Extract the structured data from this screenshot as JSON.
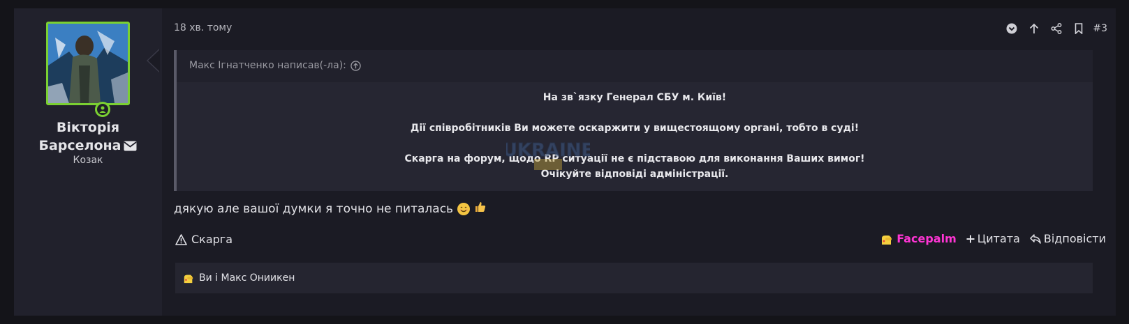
{
  "colors": {
    "avatar_border": "#7bd032",
    "reaction_accent": "#ff35d4",
    "background": "#1b1b24"
  },
  "user": {
    "name_line1": "Вікторія",
    "name_line2": "Барселона",
    "title": "Козак",
    "online": true
  },
  "post": {
    "date": "18 хв. тому",
    "number": "#3",
    "tools": [
      "chevron-down-circle-icon",
      "arrow-up-icon",
      "share-icon",
      "bookmark-icon"
    ]
  },
  "quote": {
    "header": "Макс Ігнатченко написав(-ла):",
    "lines": [
      "На зв`язку Генерал СБУ м. Київ!",
      "Дії співробітників Ви можете оскаржити у вищестоящому органі, тобто в суді!",
      "Скарга на форум, щодо RP ситуації не є підставою для виконання Ваших вимог!",
      "Очікуйте відповіді адміністрації."
    ],
    "watermark": "UKRAINE"
  },
  "message": {
    "text": "дякую але вашої думки я точно не питалась"
  },
  "footer": {
    "report": "Скарга",
    "reaction": "Facepalm",
    "quote": "Цитата",
    "reply": "Відповісти"
  },
  "reactions": {
    "summary": "Ви і Макс Ониикен"
  }
}
